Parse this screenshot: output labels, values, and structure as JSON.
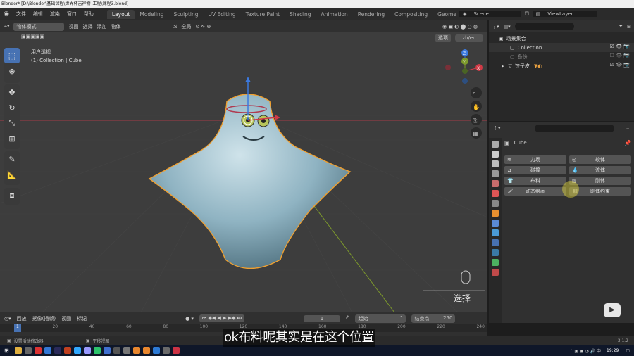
{
  "title": "Blender* [D:\\Blender\\基础课程\\世界杯吉祥物_工程\\课程3.blend]",
  "menus": [
    "文件",
    "编辑",
    "渲染",
    "窗口",
    "帮助"
  ],
  "workspaces": [
    "Layout",
    "Modeling",
    "Sculpting",
    "UV Editing",
    "Texture Paint",
    "Shading",
    "Animation",
    "Rendering",
    "Compositing",
    "Geometr"
  ],
  "active_workspace": "Layout",
  "scene_label": "Scene",
  "viewlayer_label": "ViewLayer",
  "header": {
    "mode": "物体模式",
    "view": "视图",
    "select": "选择",
    "add": "添加",
    "object": "物体",
    "transform_orientation": "全局",
    "options": "选项",
    "lang": "zh/en"
  },
  "viewport": {
    "view_name": "用户透视",
    "collection_info": "(1) Collection | Cube",
    "hint_label": "选择",
    "axes": {
      "x": "X",
      "y": "Y",
      "z": "Z"
    }
  },
  "outliner": {
    "root": "场景集合",
    "items": [
      {
        "name": "Collection"
      },
      {
        "name": "备份"
      },
      {
        "name": "饺子皮"
      }
    ]
  },
  "properties": {
    "object_name": "Cube",
    "buttons": [
      {
        "label": "力场"
      },
      {
        "label": "软体"
      },
      {
        "label": "碰撞"
      },
      {
        "label": "流体"
      },
      {
        "label": "布料"
      },
      {
        "label": "刚体"
      },
      {
        "label": "动态绘画"
      },
      {
        "label": "刚体约束"
      }
    ]
  },
  "timeline": {
    "playback": "回放",
    "keying": "抠像(插帧)",
    "view": "视图",
    "marker": "标记",
    "current_frame": "1",
    "start_label": "起始",
    "start": "1",
    "end_label": "结束点",
    "end": "250",
    "ruler": [
      "1",
      "20",
      "40",
      "60",
      "80",
      "100",
      "120",
      "140",
      "160",
      "180",
      "200",
      "220",
      "240"
    ]
  },
  "status": {
    "left": "设置活动修改器",
    "mid": "平移视图",
    "version": "3.1.2"
  },
  "clock": "19:29",
  "subtitle": "ok布料呢其实是在这个位置"
}
